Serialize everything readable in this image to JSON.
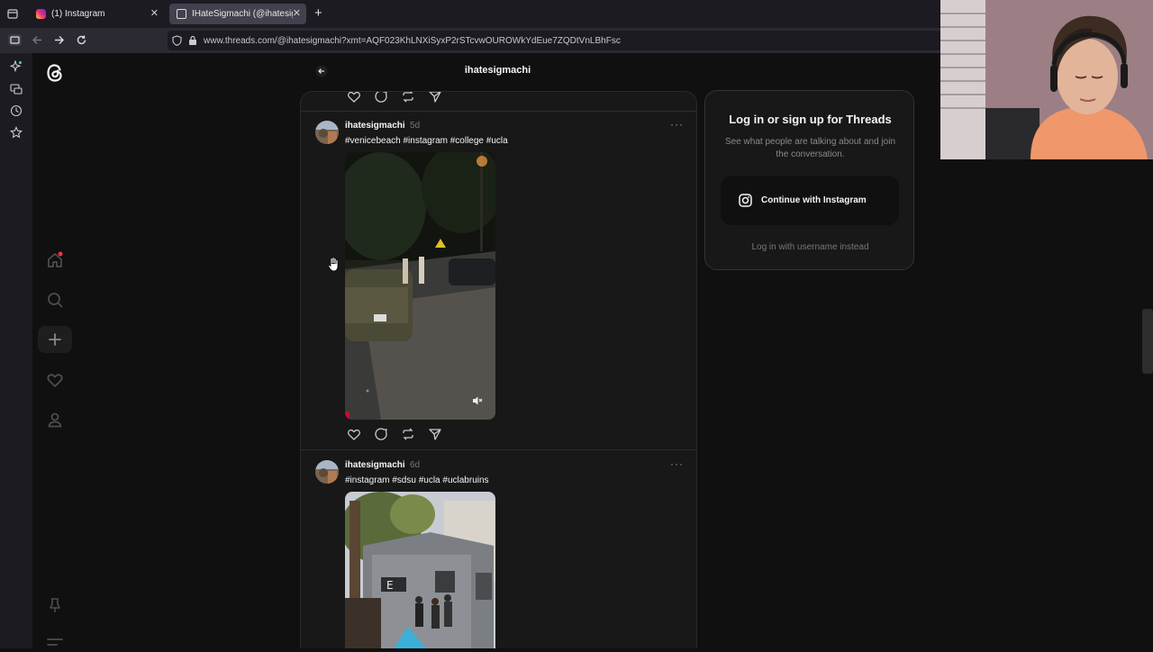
{
  "browser": {
    "tabs": [
      {
        "label": "(1) Instagram",
        "active": false
      },
      {
        "label": "IHateSigmachi (@ihatesigmachi",
        "active": true
      }
    ],
    "url": "www.threads.com/@ihatesigmachi?xmt=AQF023KhLNXiSyxP2rSTcvwOUROWkYdEue7ZQDtVnLBhFsc"
  },
  "header": {
    "title": "ihatesigmachi"
  },
  "posts": [
    {
      "username": "ihatesigmachi",
      "time": "5d",
      "tags": "#venicebeach #instagram #college #ucla",
      "media": "night street video with parked car"
    },
    {
      "username": "ihatesigmachi",
      "time": "6d",
      "tags": "#instagram #sdsu #ucla #uclabruins",
      "media": "photo of fraternity house"
    }
  ],
  "login": {
    "title": "Log in or sign up for Threads",
    "subtitle": "See what people are talking about and join the conversation.",
    "button": "Continue with Instagram",
    "alt": "Log in with username instead"
  },
  "icons": {
    "colors": {
      "background": "#101010",
      "card": "#181818",
      "text": "#f3f5f7",
      "muted": "#777777"
    }
  }
}
